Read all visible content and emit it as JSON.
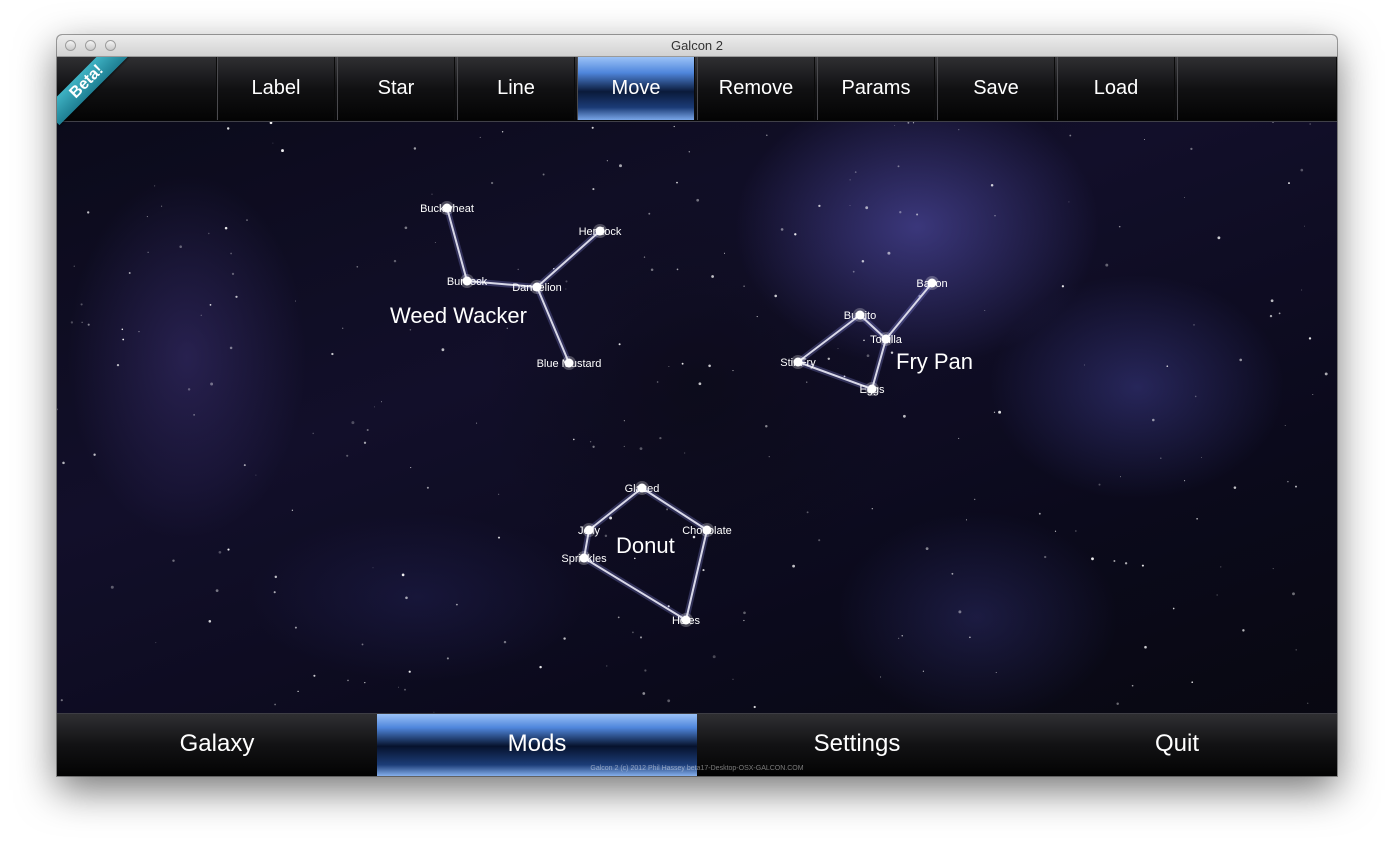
{
  "window": {
    "title": "Galcon 2",
    "traffic_lights": [
      "close-button",
      "minimize-button",
      "zoom-button"
    ]
  },
  "beta_badge": "Beta!",
  "toolbar": {
    "items": [
      {
        "label": "Label",
        "active": false
      },
      {
        "label": "Star",
        "active": false
      },
      {
        "label": "Line",
        "active": false
      },
      {
        "label": "Move",
        "active": true
      },
      {
        "label": "Remove",
        "active": false
      },
      {
        "label": "Params",
        "active": false
      },
      {
        "label": "Save",
        "active": false
      },
      {
        "label": "Load",
        "active": false
      }
    ]
  },
  "constellations": [
    {
      "name": "Weed Wacker",
      "stars": [
        "Buckwheat",
        "Hemlock",
        "Burdock",
        "Dandelion",
        "Blue Mustard"
      ],
      "links": [
        [
          "Buckwheat",
          "Burdock"
        ],
        [
          "Burdock",
          "Dandelion"
        ],
        [
          "Dandelion",
          "Hemlock"
        ],
        [
          "Dandelion",
          "Blue Mustard"
        ]
      ]
    },
    {
      "name": "Fry Pan",
      "stars": [
        "Bacon",
        "Burrito",
        "Tortilla",
        "Stir Fry",
        "Eggs"
      ],
      "links": [
        [
          "Bacon",
          "Tortilla"
        ],
        [
          "Burrito",
          "Tortilla"
        ],
        [
          "Burrito",
          "Stir Fry"
        ],
        [
          "Stir Fry",
          "Eggs"
        ],
        [
          "Tortilla",
          "Eggs"
        ]
      ]
    },
    {
      "name": "Donut",
      "stars": [
        "Glazed",
        "Jelly",
        "Chocolate",
        "Sprinkles",
        "Holes"
      ],
      "links": [
        [
          "Glazed",
          "Jelly"
        ],
        [
          "Glazed",
          "Chocolate"
        ],
        [
          "Jelly",
          "Sprinkles"
        ],
        [
          "Chocolate",
          "Holes"
        ],
        [
          "Sprinkles",
          "Holes"
        ]
      ]
    }
  ],
  "bottom_nav": {
    "items": [
      {
        "label": "Galaxy",
        "active": false
      },
      {
        "label": "Mods",
        "active": true
      },
      {
        "label": "Settings",
        "active": false
      },
      {
        "label": "Quit",
        "active": false
      }
    ]
  },
  "footer_credit": "Galcon 2 (c) 2012 Phil Hassey beta17-Desktop-OSX-GALCON.COM",
  "colors": {
    "active_button": "#4f86dc",
    "beta_ribbon": "#2a98ab",
    "star": "#ffffff",
    "link": "#d8d8e8"
  }
}
